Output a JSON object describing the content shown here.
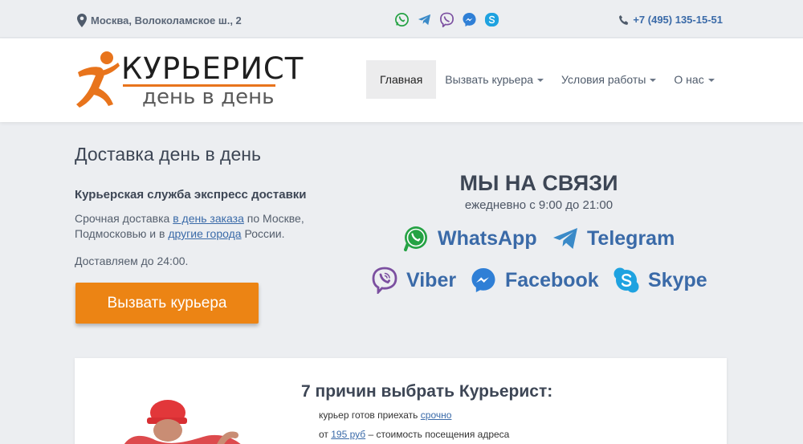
{
  "topbar": {
    "address": "Москва, Волоколамское ш., 2",
    "phone": "+7 (495) 135-15-51",
    "messenger_icons": [
      "whatsapp-icon",
      "telegram-icon",
      "viber-icon",
      "messenger-icon",
      "skype-icon"
    ]
  },
  "logo": {
    "brand": "КУРЬЕРИСТ",
    "tagline": "день в день"
  },
  "nav": {
    "items": [
      {
        "label": "Главная"
      },
      {
        "label": "Вызвать курьера"
      },
      {
        "label": "Условия работы"
      },
      {
        "label": "О нас"
      }
    ]
  },
  "hero": {
    "title": "Доставка день в день",
    "subtitle": "Курьерская служба экспресс доставки",
    "text_1": "Срочная доставка ",
    "link_1": "в день заказа",
    "text_2": " по Москве, Подмосковью и в ",
    "link_2": "другие города",
    "text_3": " России.",
    "time": "Доставляем до 24:00.",
    "cta": "Вызвать курьера"
  },
  "contacts": {
    "title": "МЫ НА СВЯЗИ",
    "hours": "ежедневно с 9:00 до 21:00",
    "messengers": [
      {
        "label": "WhatsApp",
        "icon": "whatsapp-icon",
        "color": "#25a244"
      },
      {
        "label": "Telegram",
        "icon": "telegram-icon",
        "color": "#3a8ac8"
      },
      {
        "label": "Viber",
        "icon": "viber-icon",
        "color": "#7b4fa0"
      },
      {
        "label": "Facebook",
        "icon": "messenger-icon",
        "color": "#2f7fd6"
      },
      {
        "label": "Skype",
        "icon": "skype-icon",
        "color": "#1ea2e0"
      }
    ]
  },
  "reasons": {
    "title": "7 причин выбрать Курьерист:",
    "r1_text": "курьер готов приехать ",
    "r1_link": "срочно",
    "r2_prefix": "от ",
    "r2_link": "195 руб",
    "r2_text": " – стоимость посещения адреса"
  },
  "colors": {
    "accent": "#ec8414",
    "link": "#3a6aa8",
    "background": "#eceef1"
  }
}
